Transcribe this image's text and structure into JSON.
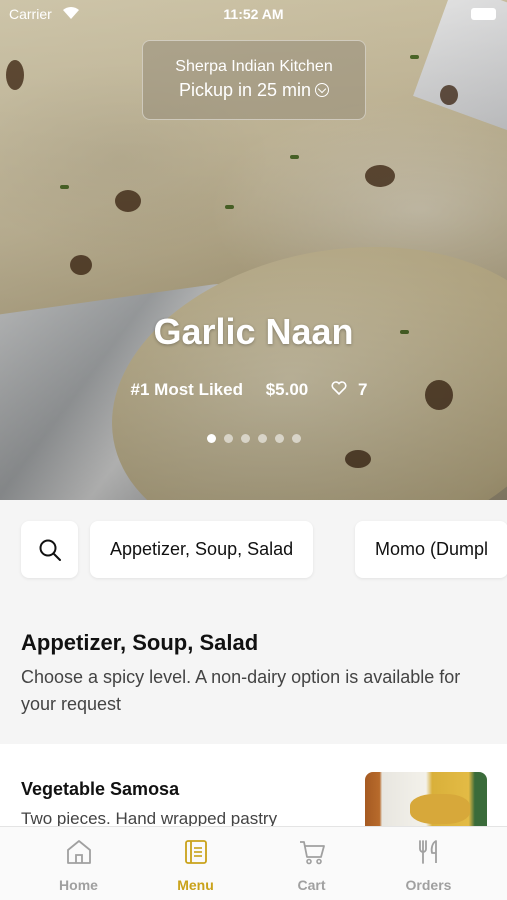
{
  "status_bar": {
    "carrier": "Carrier",
    "time": "11:52 AM"
  },
  "restaurant": {
    "name": "Sherpa Indian Kitchen",
    "pickup": "Pickup in 25 min"
  },
  "featured": {
    "title": "Garlic Naan",
    "badge": "#1 Most Liked",
    "price": "$5.00",
    "likes": "7",
    "slide_count": 6,
    "active_slide": 1
  },
  "categories": [
    "Appetizer, Soup, Salad",
    "Momo (Dumpl"
  ],
  "section": {
    "title": "Appetizer, Soup, Salad",
    "description": "Choose a spicy level. A non-dairy option is available for your request"
  },
  "items": [
    {
      "name": "Vegetable Samosa",
      "description": "Two pieces. Hand wrapped pastry"
    }
  ],
  "tabs": [
    {
      "label": "Home",
      "icon": "home-icon",
      "active": false
    },
    {
      "label": "Menu",
      "icon": "menu-book-icon",
      "active": true
    },
    {
      "label": "Cart",
      "icon": "cart-icon",
      "active": false
    },
    {
      "label": "Orders",
      "icon": "fork-knife-icon",
      "active": false
    }
  ],
  "colors": {
    "accent": "#c9a21a",
    "inactive": "#a0a0a0"
  }
}
